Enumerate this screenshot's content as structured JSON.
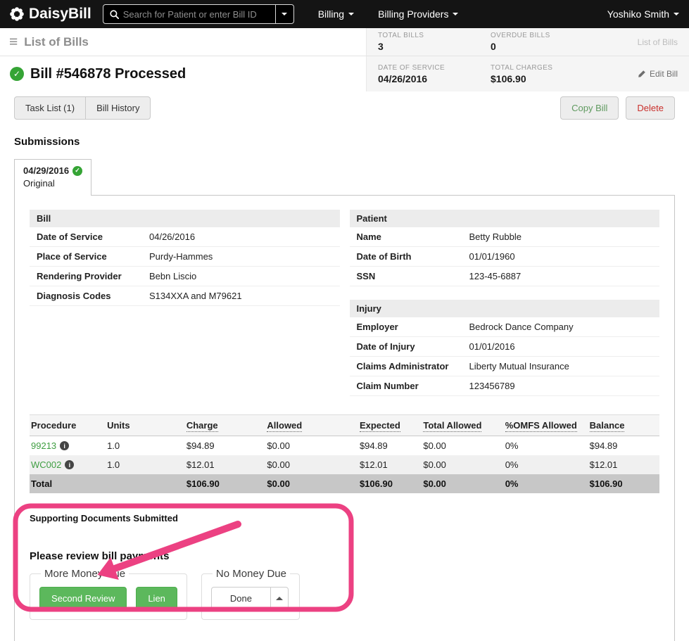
{
  "navbar": {
    "brand": "DaisyBill",
    "search_placeholder": "Search for Patient or enter Bill ID",
    "menus": [
      {
        "label": "Billing"
      },
      {
        "label": "Billing Providers"
      }
    ],
    "user": "Yoshiko Smith"
  },
  "subheader": {
    "title": "List of Bills",
    "stats": [
      {
        "label": "TOTAL BILLS",
        "value": "3"
      },
      {
        "label": "OVERDUE BILLS",
        "value": "0"
      }
    ],
    "breadcrumb": "List of Bills"
  },
  "bill_header": {
    "title": "Bill #546878 Processed",
    "stats": [
      {
        "label": "DATE OF SERVICE",
        "value": "04/26/2016"
      },
      {
        "label": "TOTAL CHARGES",
        "value": "$106.90"
      }
    ],
    "edit_label": "Edit Bill"
  },
  "toolbar": {
    "tabs": [
      {
        "label": "Task List (1)"
      },
      {
        "label": "Bill History"
      }
    ],
    "copy_label": "Copy Bill",
    "delete_label": "Delete"
  },
  "submissions": {
    "heading": "Submissions",
    "tab": {
      "date": "04/29/2016",
      "sub": "Original"
    }
  },
  "bill_details": {
    "section": "Bill",
    "rows": [
      {
        "label": "Date of Service",
        "value": "04/26/2016"
      },
      {
        "label": "Place of Service",
        "value": "Purdy-Hammes"
      },
      {
        "label": "Rendering Provider",
        "value": "Bebn Liscio"
      },
      {
        "label": "Diagnosis Codes",
        "value": "S134XXA and M79621"
      }
    ]
  },
  "patient": {
    "section": "Patient",
    "rows": [
      {
        "label": "Name",
        "value": "Betty Rubble"
      },
      {
        "label": "Date of Birth",
        "value": "01/01/1960"
      },
      {
        "label": "SSN",
        "value": "123-45-6887"
      }
    ]
  },
  "injury": {
    "section": "Injury",
    "rows": [
      {
        "label": "Employer",
        "value": "Bedrock Dance Company"
      },
      {
        "label": "Date of Injury",
        "value": "01/01/2016"
      },
      {
        "label": "Claims Administrator",
        "value": "Liberty Mutual Insurance"
      },
      {
        "label": "Claim Number",
        "value": "123456789"
      }
    ]
  },
  "procedures": {
    "headers": [
      "Procedure",
      "Units",
      "Charge",
      "Allowed",
      "Expected",
      "Total Allowed",
      "%OMFS Allowed",
      "Balance"
    ],
    "rows": [
      {
        "code": "99213",
        "units": "1.0",
        "charge": "$94.89",
        "allowed": "$0.00",
        "expected": "$94.89",
        "total_allowed": "$0.00",
        "omfs": "0%",
        "balance": "$94.89"
      },
      {
        "code": "WC002",
        "units": "1.0",
        "charge": "$12.01",
        "allowed": "$0.00",
        "expected": "$12.01",
        "total_allowed": "$0.00",
        "omfs": "0%",
        "balance": "$12.01"
      }
    ],
    "total": {
      "label": "Total",
      "charge": "$106.90",
      "allowed": "$0.00",
      "expected": "$106.90",
      "total_allowed": "$0.00",
      "omfs": "0%",
      "balance": "$106.90"
    }
  },
  "supporting_docs": "Supporting Documents Submitted",
  "review": {
    "heading": "Please review bill payments",
    "more_money": {
      "legend": "More Money Due",
      "buttons": [
        {
          "label": "Second Review"
        },
        {
          "label": "Lien"
        }
      ]
    },
    "no_money": {
      "legend": "No Money Due",
      "button": "Done"
    }
  },
  "icons": {
    "check": "✓",
    "info": "i",
    "list": "≡"
  },
  "colors": {
    "brand_green": "#35a435",
    "button_green": "#5cb85c",
    "delete_red": "#c9302c",
    "annotation_pink": "#ec4182",
    "navbar_black": "#141414"
  }
}
